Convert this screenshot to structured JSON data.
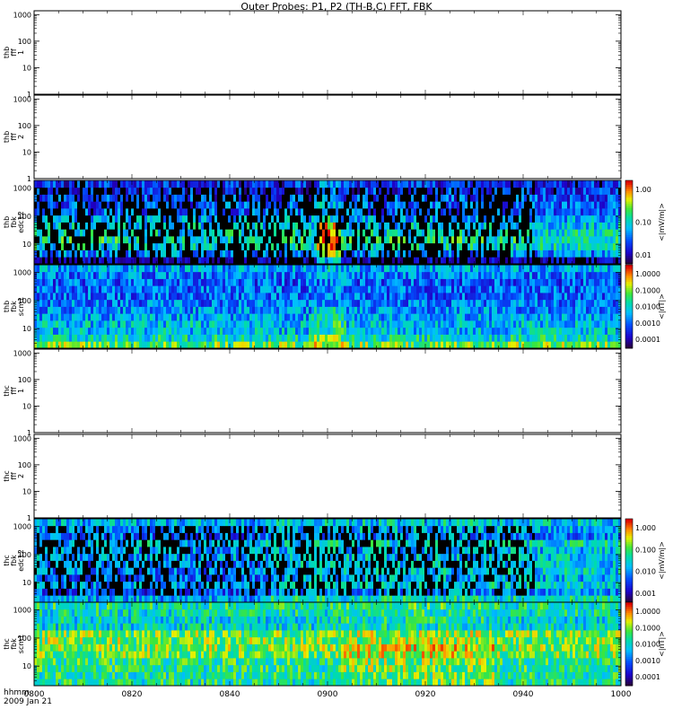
{
  "figure": {
    "title": "Outer Probes: P1, P2 (TH-B,C) FFT, FBK",
    "date_label": "2009 Jan 21",
    "time_axis_label": "hhmm"
  },
  "chart_data": {
    "type": "heatmap",
    "x_ticks": [
      "0800",
      "0820",
      "0840",
      "0900",
      "0920",
      "0940",
      "1000"
    ],
    "x_range": [
      "0800",
      "1000"
    ],
    "y_scale": "log",
    "grid": false,
    "panels": [
      {
        "label": [
          "thb",
          "fff",
          "1"
        ],
        "y_ticks": [
          "1",
          "10",
          "100",
          "1000"
        ],
        "empty": true
      },
      {
        "label": [
          "thb",
          "fff",
          "2"
        ],
        "y_ticks": [
          "1",
          "10",
          "100",
          "1000"
        ],
        "empty": true
      },
      {
        "label": [
          "thb",
          "fbk",
          "edc12"
        ],
        "y_ticks": [
          "10",
          "100",
          "1000"
        ],
        "empty": false,
        "colorbar": {
          "unit": "<|mV/m|>",
          "ticks": [
            "1.00",
            "0.10",
            "0.01"
          ],
          "scale": "log"
        }
      },
      {
        "label": [
          "thb",
          "fbk",
          "scm1"
        ],
        "y_ticks": [
          "10",
          "100",
          "1000"
        ],
        "empty": false,
        "colorbar": {
          "unit": "<|nT|>",
          "ticks": [
            "1.0000",
            "0.1000",
            "0.0100",
            "0.0010",
            "0.0001"
          ],
          "scale": "log"
        }
      },
      {
        "label": [
          "thc",
          "fff",
          "1"
        ],
        "y_ticks": [
          "1",
          "10",
          "100",
          "1000"
        ],
        "empty": true
      },
      {
        "label": [
          "thc",
          "fff",
          "2"
        ],
        "y_ticks": [
          "1",
          "10",
          "100",
          "1000"
        ],
        "empty": true
      },
      {
        "label": [
          "thc",
          "fbk",
          "edc12"
        ],
        "y_ticks": [
          "10",
          "100",
          "1000"
        ],
        "empty": false,
        "colorbar": {
          "unit": "<|mV/m|>",
          "ticks": [
            "1.000",
            "0.100",
            "0.010",
            "0.001"
          ],
          "scale": "log"
        }
      },
      {
        "label": [
          "thc",
          "fbk",
          "scm1"
        ],
        "y_ticks": [
          "10",
          "100",
          "1000"
        ],
        "empty": false,
        "colorbar": {
          "unit": "<|nT|>",
          "ticks": [
            "1.0000",
            "0.1000",
            "0.0100",
            "0.0010",
            "0.0001"
          ],
          "scale": "log"
        }
      }
    ]
  }
}
